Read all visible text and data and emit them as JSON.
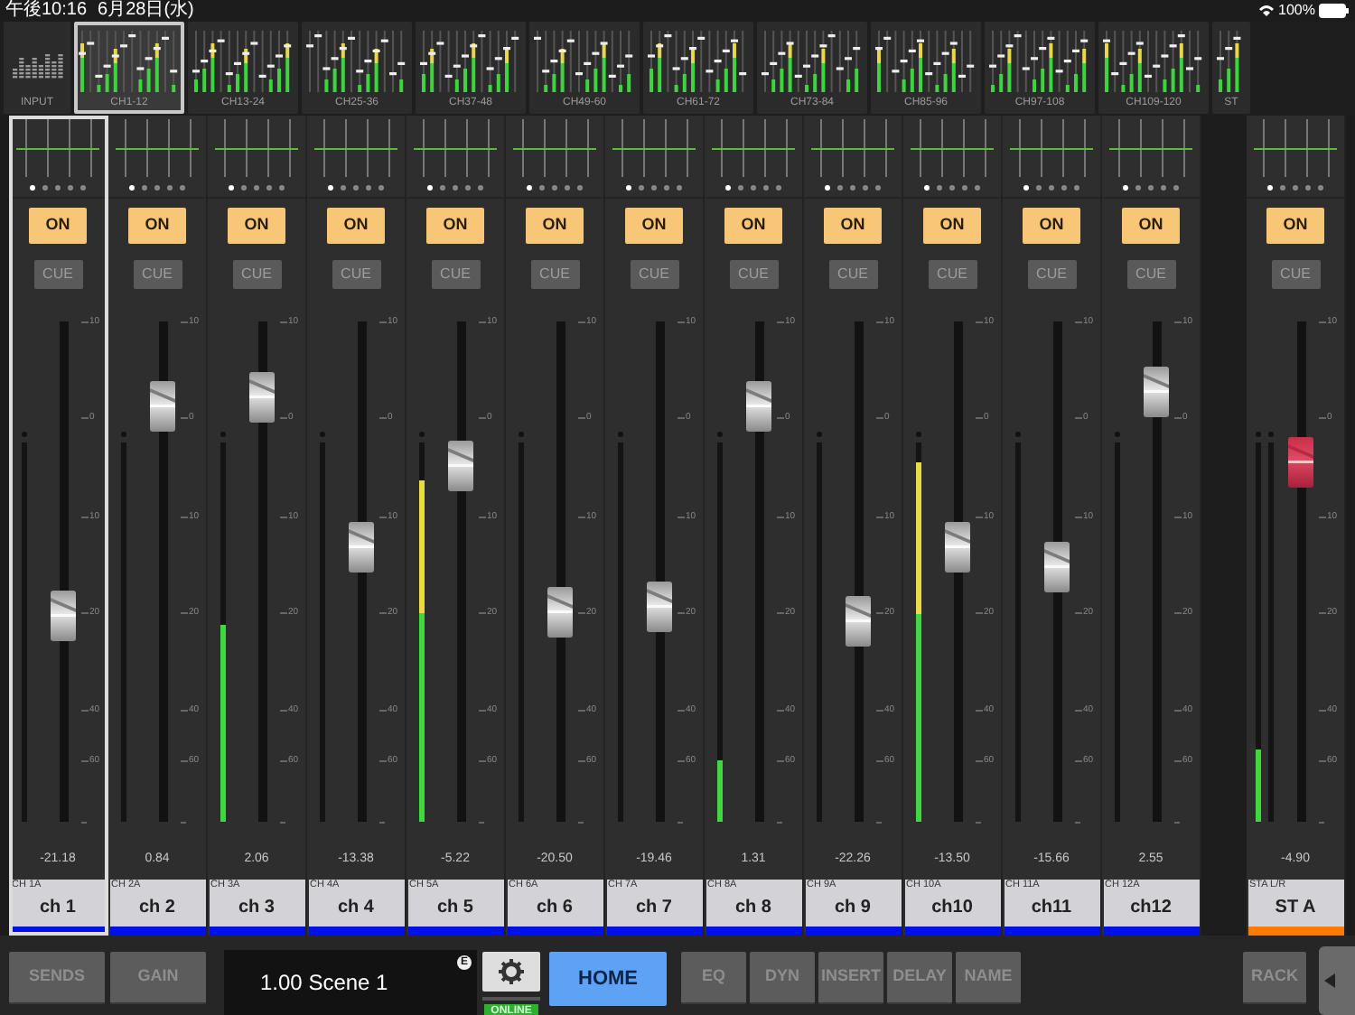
{
  "status_bar": {
    "time": "午後10:16",
    "date": "6月28日(水)",
    "battery": "100%"
  },
  "banks": [
    {
      "label": "INPUT",
      "kind": "input",
      "selected": false
    },
    {
      "label": "CH1-12",
      "kind": "channels",
      "selected": true
    },
    {
      "label": "CH13-24",
      "kind": "channels",
      "selected": false
    },
    {
      "label": "CH25-36",
      "kind": "channels",
      "selected": false
    },
    {
      "label": "CH37-48",
      "kind": "channels",
      "selected": false
    },
    {
      "label": "CH49-60",
      "kind": "channels",
      "selected": false
    },
    {
      "label": "CH61-72",
      "kind": "channels",
      "selected": false
    },
    {
      "label": "CH73-84",
      "kind": "channels",
      "selected": false
    },
    {
      "label": "CH85-96",
      "kind": "channels",
      "selected": false
    },
    {
      "label": "CH97-108",
      "kind": "channels",
      "selected": false
    },
    {
      "label": "CH109-120",
      "kind": "channels",
      "selected": false
    },
    {
      "label": "ST",
      "kind": "stereo",
      "selected": false
    }
  ],
  "channels": [
    {
      "kind": "mono",
      "on_label": "ON",
      "on": true,
      "cue_label": "CUE",
      "cue": false,
      "scale": [
        "10",
        "0",
        "10",
        "20",
        "40",
        "60"
      ],
      "meters": [
        {
          "level": 0
        }
      ],
      "fader": {
        "level": 0.41
      },
      "value": "-21.18",
      "id": "CH 1A",
      "name": "ch 1",
      "selected": true,
      "color": "#0010e8"
    },
    {
      "kind": "mono",
      "on_label": "ON",
      "on": true,
      "cue_label": "CUE",
      "cue": false,
      "scale": [
        "10",
        "0",
        "10",
        "20",
        "40",
        "60"
      ],
      "meters": [
        {
          "level": 0
        }
      ],
      "fader": {
        "level": 0.83
      },
      "value": "0.84",
      "id": "CH 2A",
      "name": "ch 2",
      "selected": false,
      "color": "#0010e8"
    },
    {
      "kind": "mono",
      "on_label": "ON",
      "on": true,
      "cue_label": "CUE",
      "cue": false,
      "scale": [
        "10",
        "0",
        "10",
        "20",
        "40",
        "60"
      ],
      "meters": [
        {
          "level": 0.52
        }
      ],
      "fader": {
        "level": 0.85
      },
      "value": "2.06",
      "id": "CH 3A",
      "name": "ch 3",
      "selected": false,
      "color": "#0010e8"
    },
    {
      "kind": "mono",
      "on_label": "ON",
      "on": true,
      "cue_label": "CUE",
      "cue": false,
      "scale": [
        "10",
        "0",
        "10",
        "20",
        "40",
        "60"
      ],
      "meters": [
        {
          "level": 0
        }
      ],
      "fader": {
        "level": 0.55
      },
      "value": "-13.38",
      "id": "CH 4A",
      "name": "ch 4",
      "selected": false,
      "color": "#0010e8"
    },
    {
      "kind": "mono",
      "on_label": "ON",
      "on": true,
      "cue_label": "CUE",
      "cue": false,
      "scale": [
        "10",
        "0",
        "10",
        "20",
        "40",
        "60"
      ],
      "meters": [
        {
          "level": 0.9
        }
      ],
      "fader": {
        "level": 0.71
      },
      "value": "-5.22",
      "id": "CH 5A",
      "name": "ch 5",
      "selected": false,
      "color": "#0010e8"
    },
    {
      "kind": "mono",
      "on_label": "ON",
      "on": true,
      "cue_label": "CUE",
      "cue": false,
      "scale": [
        "10",
        "0",
        "10",
        "20",
        "40",
        "60"
      ],
      "meters": [
        {
          "level": 0
        }
      ],
      "fader": {
        "level": 0.42
      },
      "value": "-20.50",
      "id": "CH 6A",
      "name": "ch 6",
      "selected": false,
      "color": "#0010e8"
    },
    {
      "kind": "mono",
      "on_label": "ON",
      "on": true,
      "cue_label": "CUE",
      "cue": false,
      "scale": [
        "10",
        "0",
        "10",
        "20",
        "40",
        "60"
      ],
      "meters": [
        {
          "level": 0
        }
      ],
      "fader": {
        "level": 0.43
      },
      "value": "-19.46",
      "id": "CH 7A",
      "name": "ch 7",
      "selected": false,
      "color": "#0010e8"
    },
    {
      "kind": "mono",
      "on_label": "ON",
      "on": true,
      "cue_label": "CUE",
      "cue": false,
      "scale": [
        "10",
        "0",
        "10",
        "20",
        "40",
        "60"
      ],
      "meters": [
        {
          "level": 0.16
        }
      ],
      "fader": {
        "level": 0.83
      },
      "value": "1.31",
      "id": "CH 8A",
      "name": "ch 8",
      "selected": false,
      "color": "#0010e8"
    },
    {
      "kind": "mono",
      "on_label": "ON",
      "on": true,
      "cue_label": "CUE",
      "cue": false,
      "scale": [
        "10",
        "0",
        "10",
        "20",
        "40",
        "60"
      ],
      "meters": [
        {
          "level": 0
        }
      ],
      "fader": {
        "level": 0.4
      },
      "value": "-22.26",
      "id": "CH 9A",
      "name": "ch 9",
      "selected": false,
      "color": "#0010e8"
    },
    {
      "kind": "mono",
      "on_label": "ON",
      "on": true,
      "cue_label": "CUE",
      "cue": false,
      "scale": [
        "10",
        "0",
        "10",
        "20",
        "40",
        "60"
      ],
      "meters": [
        {
          "level": 0.95
        }
      ],
      "fader": {
        "level": 0.55
      },
      "value": "-13.50",
      "id": "CH 10A",
      "name": "ch10",
      "selected": false,
      "color": "#0010e8"
    },
    {
      "kind": "mono",
      "on_label": "ON",
      "on": true,
      "cue_label": "CUE",
      "cue": false,
      "scale": [
        "10",
        "0",
        "10",
        "20",
        "40",
        "60"
      ],
      "meters": [
        {
          "level": 0
        }
      ],
      "fader": {
        "level": 0.51
      },
      "value": "-15.66",
      "id": "CH 11A",
      "name": "ch11",
      "selected": false,
      "color": "#0010e8"
    },
    {
      "kind": "mono",
      "on_label": "ON",
      "on": true,
      "cue_label": "CUE",
      "cue": false,
      "scale": [
        "10",
        "0",
        "10",
        "20",
        "40",
        "60"
      ],
      "meters": [
        {
          "level": 0
        }
      ],
      "fader": {
        "level": 0.86
      },
      "value": "2.55",
      "id": "CH 12A",
      "name": "ch12",
      "selected": false,
      "color": "#0010e8"
    },
    {
      "kind": "stereo",
      "on_label": "ON",
      "on": true,
      "cue_label": "CUE",
      "cue": false,
      "scale": [
        "10",
        "0",
        "10",
        "20",
        "40",
        "60"
      ],
      "meters": [
        {
          "level": 0.19
        },
        {
          "level": 0
        }
      ],
      "fader": {
        "level": 0.72
      },
      "value": "-4.90",
      "id": "STA L/R",
      "name": "ST A",
      "selected": false,
      "color": "#ff7a00"
    }
  ],
  "toolbar": {
    "left": [
      {
        "label": "SENDS"
      },
      {
        "label": "GAIN"
      }
    ],
    "scene": "1.00 Scene 1",
    "scene_badge": "E",
    "online": "ONLINE",
    "home": {
      "label": "HOME",
      "selected": true
    },
    "views": [
      {
        "label": "EQ",
        "selected": false
      },
      {
        "label": "DYN",
        "selected": false
      },
      {
        "label": "INSERT",
        "selected": false
      },
      {
        "label": "DELAY",
        "selected": false
      },
      {
        "label": "NAME",
        "selected": false
      }
    ],
    "rack": "RACK"
  }
}
